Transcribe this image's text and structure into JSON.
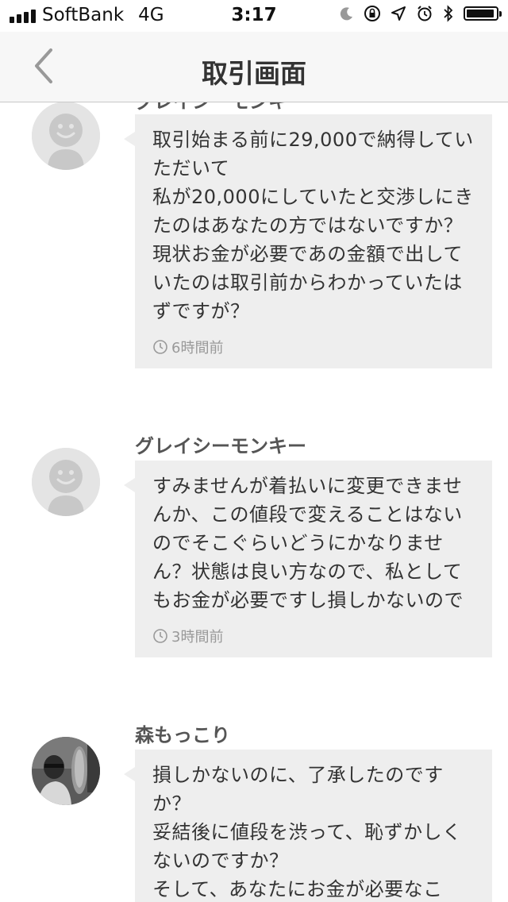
{
  "status_bar": {
    "carrier": "SoftBank",
    "network": "4G",
    "time": "3:17"
  },
  "nav": {
    "title": "取引画面",
    "back_icon": "chevron-left-icon"
  },
  "messages": [
    {
      "sender": "グレイシーモンキー",
      "text": "取引始まる前に29,000で納得していただいて\n私が20,000にしていたと交渉しにきたのはあなたの方ではないですか？\n現状お金が必要であの金額で出していたのは取引前からわかっていたはずですが？",
      "time": "6時間前"
    },
    {
      "sender": "グレイシーモンキー",
      "text": "すみませんが着払いに変更できませんか、この値段で変えることはないのでそこぐらいどうにかなりません？状態は良い方なので、私としてもお金が必要ですし損しかないので",
      "time": "3時間前"
    },
    {
      "sender": "森もっこり",
      "text": "損しかないのに、了承したのですか？\n妥結後に値段を渋って、恥ずかしくないのですか？\nそして、あなたにお金が必要なこ",
      "time": ""
    }
  ],
  "colors": {
    "bubble": "#eeeeee",
    "nav_bg": "#f7f7f7",
    "timestamp": "#999999"
  }
}
